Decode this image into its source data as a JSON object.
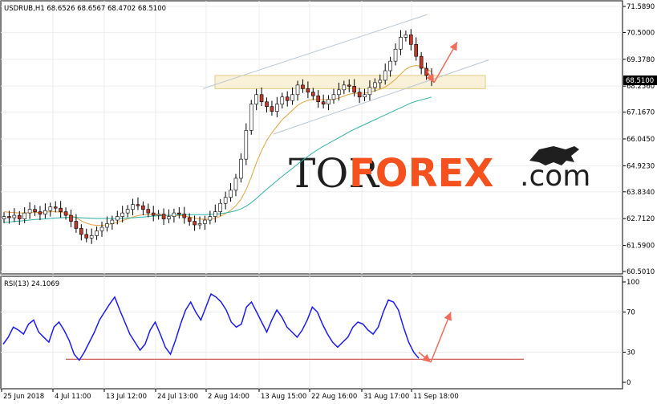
{
  "price_panel": {
    "title": "USDRUB,H1  68.6526 68.6567 68.4702 68.5100",
    "current_price": "68.5100",
    "watermark": {
      "part1": "TOR",
      "part2": "FOREX",
      "part3": ".com"
    }
  },
  "rsi_panel": {
    "title": "RSI(13) 24.1069"
  },
  "chart_data": [
    {
      "type": "line",
      "title": "USDRUB,H1",
      "ohlc_last": {
        "open": 68.6526,
        "high": 68.6567,
        "low": 68.4702,
        "close": 68.51
      },
      "ylim": [
        60.501,
        71.589
      ],
      "y_ticks": [
        "71.5890",
        "70.5000",
        "69.3780",
        "68.2560",
        "67.1670",
        "66.0450",
        "64.9230",
        "63.8340",
        "62.7120",
        "61.5900",
        "60.5010"
      ],
      "x_ticks": [
        "25 Jun 2018",
        "4 Jul 11:00",
        "13 Jul 12:00",
        "24 Jul 13:00",
        "2 Aug 14:00",
        "13 Aug 15:00",
        "22 Aug 16:00",
        "31 Aug 17:00",
        "11 Sep 18:00"
      ],
      "series": [
        {
          "kind": "candles",
          "close": [
            62.8,
            62.75,
            62.85,
            62.7,
            62.95,
            63.1,
            63.0,
            62.9,
            63.05,
            63.2,
            63.15,
            63.0,
            62.85,
            62.6,
            62.3,
            62.05,
            61.9,
            62.0,
            62.2,
            62.35,
            62.5,
            62.65,
            62.8,
            62.95,
            63.1,
            63.3,
            63.25,
            63.1,
            62.95,
            62.85,
            62.9,
            62.7,
            62.8,
            62.95,
            62.9,
            62.75,
            62.6,
            62.45,
            62.5,
            62.65,
            62.8,
            63.0,
            63.35,
            63.6,
            63.9,
            64.4,
            65.2,
            66.4,
            67.5,
            67.9,
            67.6,
            67.4,
            67.2,
            67.5,
            67.8,
            67.65,
            67.9,
            68.3,
            68.15,
            68.0,
            67.85,
            67.6,
            67.5,
            67.7,
            67.9,
            68.1,
            68.3,
            68.25,
            68.0,
            67.8,
            67.9,
            68.2,
            68.4,
            68.5,
            68.9,
            69.3,
            69.8,
            70.3,
            70.4,
            70.0,
            69.5,
            69.0,
            68.7,
            68.51
          ]
        },
        {
          "kind": "ma_fast",
          "name": "",
          "color": "#e6a23c",
          "values": [
            63.0,
            62.98,
            62.96,
            62.95,
            62.95,
            62.96,
            62.97,
            62.97,
            62.98,
            63.0,
            63.0,
            62.98,
            62.93,
            62.85,
            62.75,
            62.62,
            62.52,
            62.46,
            62.43,
            62.43,
            62.46,
            62.5,
            62.56,
            62.63,
            62.7,
            62.78,
            62.84,
            62.87,
            62.88,
            62.88,
            62.88,
            62.86,
            62.84,
            62.84,
            62.84,
            62.82,
            62.78,
            62.74,
            62.7,
            62.68,
            62.69,
            62.73,
            62.81,
            62.92,
            63.06,
            63.25,
            63.52,
            63.92,
            64.45,
            65.05,
            65.56,
            65.98,
            66.3,
            66.58,
            66.85,
            67.05,
            67.25,
            67.45,
            67.58,
            67.66,
            67.7,
            67.7,
            67.68,
            67.68,
            67.7,
            67.76,
            67.84,
            67.92,
            67.96,
            67.96,
            67.96,
            68.0,
            68.06,
            68.12,
            68.22,
            68.36,
            68.54,
            68.76,
            68.96,
            69.08,
            69.12,
            69.08,
            68.98,
            68.85
          ]
        },
        {
          "kind": "ma_slow",
          "name": "",
          "color": "#2bb5a8",
          "values": [
            62.55,
            62.57,
            62.59,
            62.61,
            62.63,
            62.65,
            62.67,
            62.69,
            62.7,
            62.72,
            62.74,
            62.75,
            62.76,
            62.76,
            62.76,
            62.75,
            62.74,
            62.73,
            62.72,
            62.72,
            62.72,
            62.72,
            62.72,
            62.73,
            62.74,
            62.75,
            62.77,
            62.78,
            62.8,
            62.82,
            62.83,
            62.84,
            62.85,
            62.86,
            62.87,
            62.88,
            62.88,
            62.88,
            62.88,
            62.88,
            62.89,
            62.9,
            62.92,
            62.95,
            62.99,
            63.04,
            63.12,
            63.23,
            63.38,
            63.56,
            63.75,
            63.94,
            64.12,
            64.3,
            64.48,
            64.65,
            64.82,
            64.99,
            65.16,
            65.32,
            65.47,
            65.61,
            65.74,
            65.86,
            65.98,
            66.1,
            66.22,
            66.34,
            66.45,
            66.55,
            66.65,
            66.75,
            66.85,
            66.95,
            67.05,
            67.15,
            67.25,
            67.35,
            67.45,
            67.55,
            67.62,
            67.68,
            67.74,
            67.8
          ]
        }
      ],
      "annotations": {
        "support_zone": [
          68.15,
          68.7
        ],
        "channel_upper": [
          [
            0.325,
            68.15
          ],
          [
            0.69,
            71.25
          ]
        ],
        "channel_lower": [
          [
            0.44,
            66.25
          ],
          [
            0.79,
            69.35
          ]
        ],
        "forecast_arrow": [
          [
            0.665,
            68.5
          ],
          [
            0.7,
            70.3
          ]
        ]
      }
    },
    {
      "type": "line",
      "title": "RSI(13) 24.1069",
      "ylim": [
        0,
        100
      ],
      "y_ticks": [
        "100",
        "70",
        "30",
        "0"
      ],
      "values": [
        38,
        45,
        55,
        52,
        48,
        58,
        62,
        50,
        45,
        40,
        55,
        60,
        52,
        42,
        28,
        22,
        30,
        40,
        50,
        62,
        70,
        78,
        85,
        72,
        60,
        48,
        40,
        32,
        38,
        52,
        60,
        48,
        35,
        28,
        42,
        58,
        72,
        80,
        70,
        62,
        75,
        88,
        85,
        80,
        72,
        60,
        55,
        58,
        75,
        80,
        70,
        60,
        50,
        62,
        72,
        65,
        55,
        50,
        45,
        52,
        62,
        75,
        70,
        58,
        48,
        40,
        35,
        40,
        45,
        55,
        60,
        58,
        52,
        48,
        55,
        70,
        82,
        80,
        72,
        55,
        40,
        30,
        24
      ],
      "reference_line": 23,
      "forecast_arrow": [
        [
          0.665,
          24
        ],
        [
          0.695,
          68
        ]
      ]
    }
  ]
}
